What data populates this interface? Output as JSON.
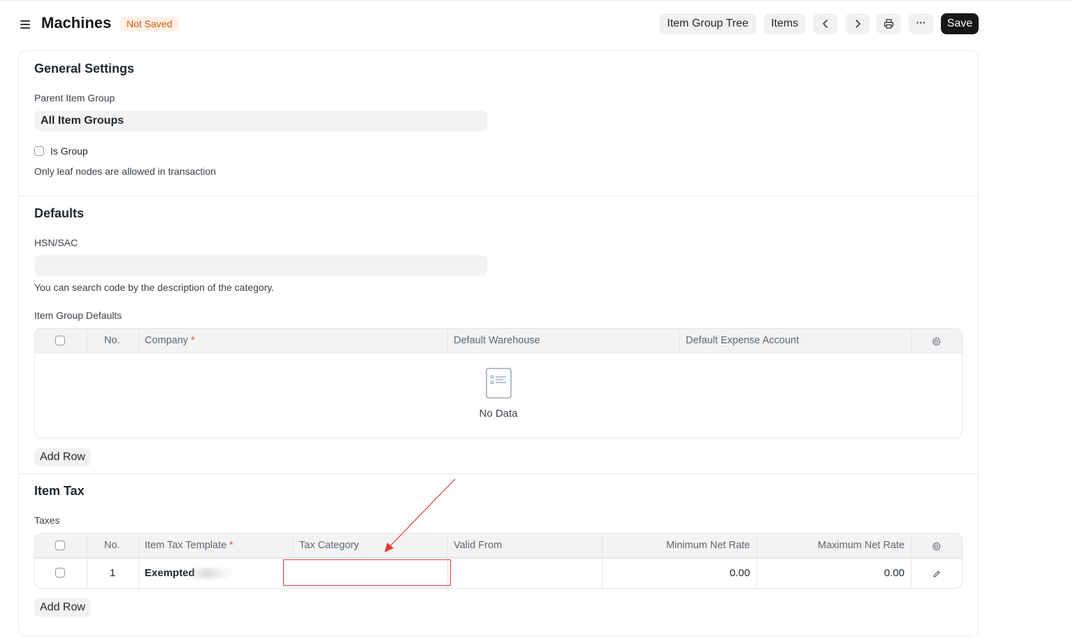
{
  "header": {
    "title": "Machines",
    "status": "Not Saved",
    "buttons": {
      "item_group_tree": "Item Group Tree",
      "items": "Items",
      "more": "···",
      "save": "Save"
    }
  },
  "general": {
    "title": "General Settings",
    "parent_label": "Parent Item Group",
    "parent_value": "All Item Groups",
    "is_group_label": "Is Group",
    "help": "Only leaf nodes are allowed in transaction"
  },
  "defaults": {
    "title": "Defaults",
    "hsn_label": "HSN/SAC",
    "hsn_value": "",
    "hsn_help": "You can search code by the description of the category.",
    "table_label": "Item Group Defaults",
    "columns": {
      "no": "No.",
      "company": "Company",
      "warehouse": "Default Warehouse",
      "expense": "Default Expense Account"
    },
    "empty_text": "No Data",
    "add_row": "Add Row"
  },
  "item_tax": {
    "title": "Item Tax",
    "table_label": "Taxes",
    "columns": {
      "no": "No.",
      "template": "Item Tax Template",
      "category": "Tax Category",
      "valid_from": "Valid From",
      "min_rate": "Minimum Net Rate",
      "max_rate": "Maximum Net Rate"
    },
    "rows": [
      {
        "no": "1",
        "template": "Exempted",
        "category": "",
        "valid_from": "",
        "min_rate": "0.00",
        "max_rate": "0.00"
      }
    ],
    "add_row": "Add Row"
  },
  "annotation": {
    "color": "#e53935"
  }
}
